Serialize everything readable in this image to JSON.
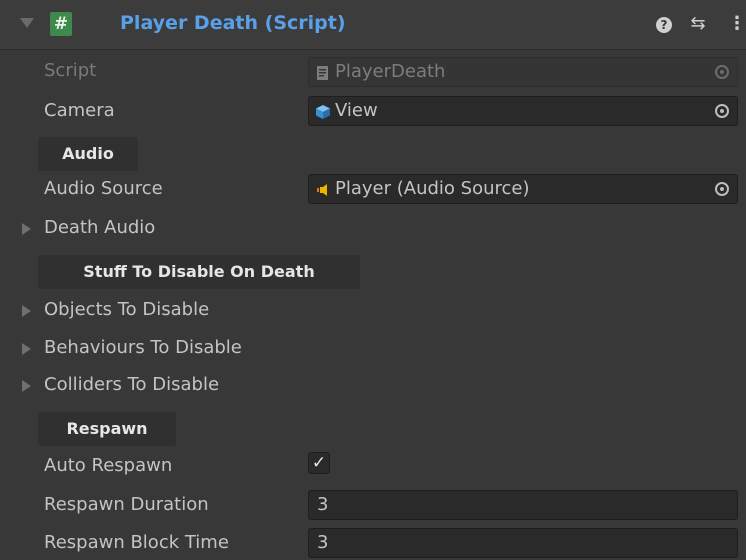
{
  "component": {
    "title": "Player Death (Script)",
    "script_icon_glyph": "#",
    "help_glyph": "?",
    "preset_glyph": "⇆",
    "menu_glyph": "⋮"
  },
  "fields": {
    "script": {
      "label": "Script",
      "value": "PlayerDeath"
    },
    "camera": {
      "label": "Camera",
      "value": "View"
    },
    "audio_source": {
      "label": "Audio Source",
      "value": "Player (Audio Source)"
    },
    "death_audio": {
      "label": "Death Audio"
    },
    "objects_to_disable": {
      "label": "Objects To Disable"
    },
    "behaviours_to_disable": {
      "label": "Behaviours To Disable"
    },
    "colliders_to_disable": {
      "label": "Colliders To Disable"
    },
    "auto_respawn": {
      "label": "Auto Respawn",
      "checked": true,
      "glyph": "✓"
    },
    "respawn_duration": {
      "label": "Respawn Duration",
      "value": "3"
    },
    "respawn_block_time": {
      "label": "Respawn Block Time",
      "value": "3"
    }
  },
  "headers": {
    "audio": "Audio",
    "stuff_to_disable": "Stuff To Disable On Death",
    "respawn": "Respawn"
  },
  "colors": {
    "title": "#5aa0e8",
    "script_icon": "#3e8a4c",
    "camera_icon": "#4aa3df",
    "audio_icon": "#f0b400"
  }
}
